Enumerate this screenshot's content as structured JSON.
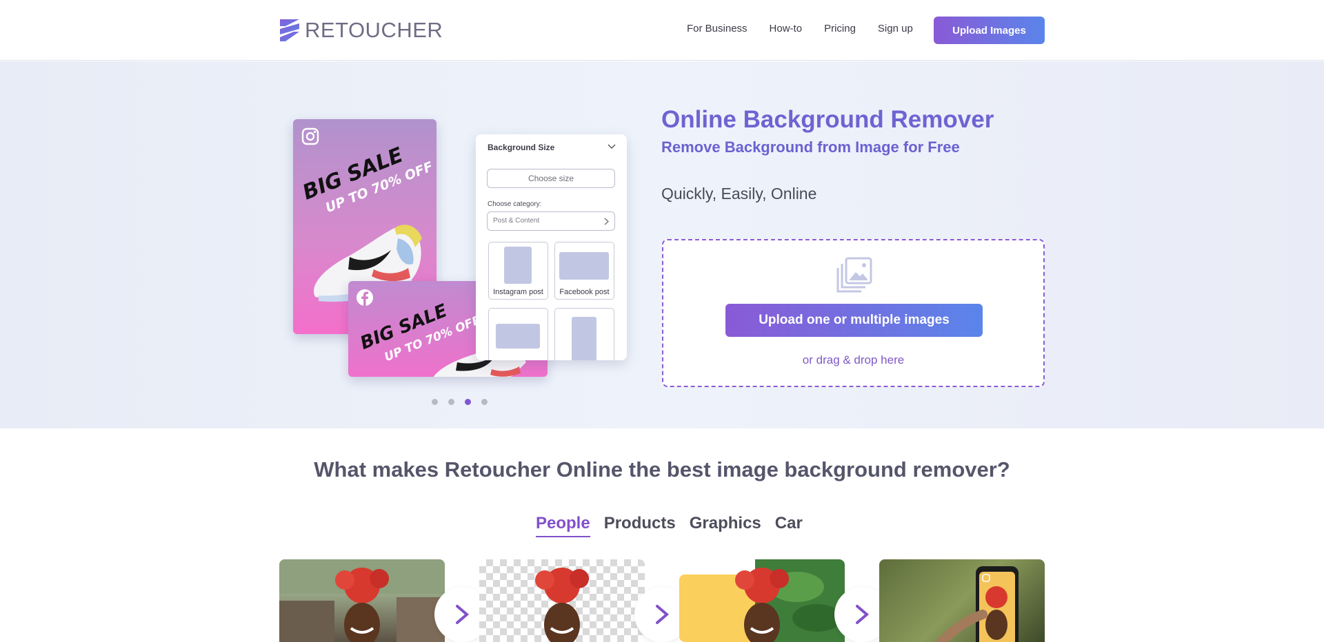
{
  "header": {
    "logo_text": "RETOUCHER",
    "nav": [
      "For Business",
      "How-to",
      "Pricing",
      "Sign up"
    ],
    "upload_button": "Upload Images"
  },
  "hero": {
    "title": "Online Background Remover",
    "subtitle": "Remove Background from Image for Free",
    "tagline": "Quickly, Easily, Online",
    "upload_button": "Upload one or multiple images",
    "drag_text": "or drag & drop here",
    "slider_active_index": 2,
    "slider_count": 4
  },
  "mockup": {
    "sale_title": "BIG SALE",
    "sale_sub": "UP TO 70% OFF",
    "panel_title": "Background Size",
    "choose_size": "Choose size",
    "category_label": "Choose category:",
    "category_value": "Post & Content",
    "tiles": [
      "Instagram post",
      "Facebook post"
    ]
  },
  "features": {
    "title": "What makes Retoucher Online the best image background remover?",
    "tabs": [
      "People",
      "Products",
      "Graphics",
      "Car"
    ],
    "active_tab": 0
  },
  "colors": {
    "accent": "#8256d1",
    "accent_blue": "#5a85ea",
    "title_purple": "#6d64d2"
  }
}
